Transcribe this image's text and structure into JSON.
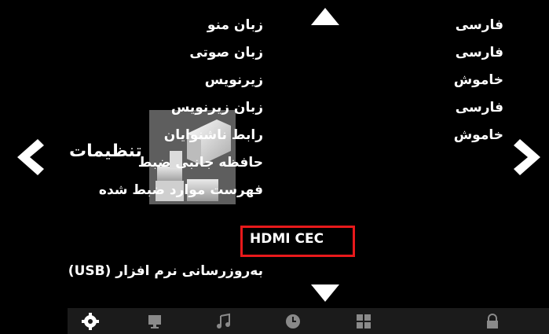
{
  "section": {
    "title": "تنظیمات"
  },
  "menu": [
    {
      "label": "زبان منو",
      "value": "فارسی"
    },
    {
      "label": "زبان صوتی",
      "value": "فارسی"
    },
    {
      "label": "زیرنویس",
      "value": "خاموش"
    },
    {
      "label": "زبان زیرنویس",
      "value": "فارسی"
    },
    {
      "label": "رابط ناشنوایان",
      "value": "خاموش"
    },
    {
      "label": "حافظه جانبی ضبط",
      "value": ""
    },
    {
      "label": "فهرست موارد ضبط شده",
      "value": ""
    },
    {
      "label": "HDMI CEC",
      "value": "",
      "highlighted": true
    },
    {
      "label": "به‌روزرسانی نرم افزار (USB)",
      "value": ""
    }
  ],
  "bottom_icons": [
    "gear-icon",
    "monitor-icon",
    "music-note-icon",
    "clock-icon",
    "grid-icon",
    "lock-icon"
  ],
  "colors": {
    "background": "#000000",
    "text": "#ffffff",
    "highlight": "#e8191b",
    "bottom_bar": "#1b1b1b"
  }
}
